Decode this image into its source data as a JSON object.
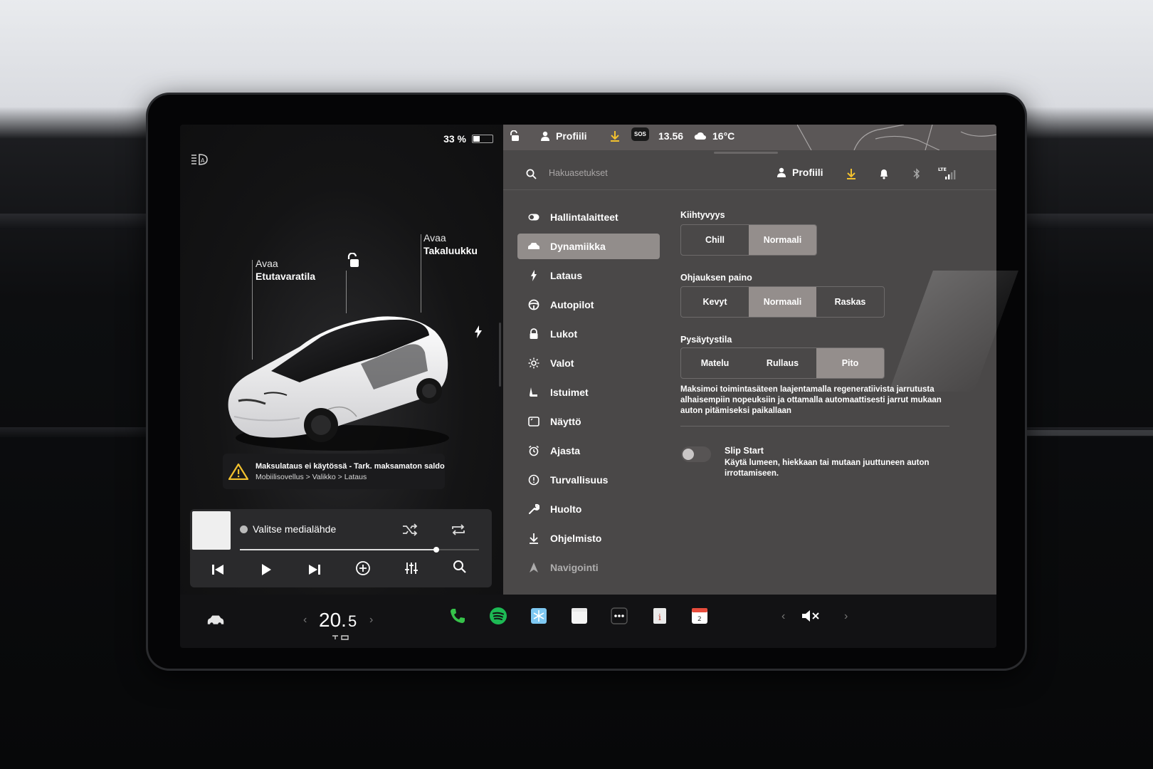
{
  "status_left": {
    "battery_text": "33 %",
    "battery_level": 0.33
  },
  "car_labels": {
    "frunk_line1": "Avaa",
    "frunk_line2": "Etutavaratila",
    "trunk_line1": "Avaa",
    "trunk_line2": "Takaluukku"
  },
  "warning": {
    "title": "Maksulataus ei käytössä - Tark. maksamaton saldo",
    "path": "Mobiilisovellus > Valikko > Lataus"
  },
  "media": {
    "source_label": "Valitse medialähde",
    "progress": 0.82
  },
  "topbar": {
    "profile": "Profiili",
    "sos": "SOS",
    "time": "13.56",
    "weather": "16°C"
  },
  "search": {
    "placeholder": "Hakuasetukset",
    "profile": "Profiili",
    "network": "LTE"
  },
  "menu": [
    {
      "label": "Hallintalaitteet",
      "icon": "toggle-icon"
    },
    {
      "label": "Dynamiikka",
      "icon": "car-icon"
    },
    {
      "label": "Lataus",
      "icon": "bolt-icon"
    },
    {
      "label": "Autopilot",
      "icon": "steering-wheel-icon"
    },
    {
      "label": "Lukot",
      "icon": "lock-icon"
    },
    {
      "label": "Valot",
      "icon": "sun-icon"
    },
    {
      "label": "Istuimet",
      "icon": "seat-icon"
    },
    {
      "label": "Näyttö",
      "icon": "display-icon"
    },
    {
      "label": "Ajasta",
      "icon": "alarm-clock-icon"
    },
    {
      "label": "Turvallisuus",
      "icon": "info-circle-icon"
    },
    {
      "label": "Huolto",
      "icon": "wrench-icon"
    },
    {
      "label": "Ohjelmisto",
      "icon": "download-icon"
    },
    {
      "label": "Navigointi",
      "icon": "navigation-icon"
    }
  ],
  "settings": {
    "acceleration": {
      "title": "Kiihtyvyys",
      "options": [
        "Chill",
        "Normaali"
      ],
      "selected": "Normaali"
    },
    "steering": {
      "title": "Ohjauksen paino",
      "options": [
        "Kevyt",
        "Normaali",
        "Raskas"
      ],
      "selected": "Normaali"
    },
    "stopping": {
      "title": "Pysäytystila",
      "options": [
        "Matelu",
        "Rullaus",
        "Pito"
      ],
      "selected": "Pito"
    },
    "stopping_desc": "Maksimoi toimintasäteen laajentamalla regeneratiivista jarrutusta alhaisempiin nopeuksiin ja ottamalla automaattisesti jarrut mukaan auton pitämiseksi paikallaan",
    "slip_start": {
      "title": "Slip Start",
      "desc": "Käytä lumeen, hiekkaan tai mutaan juuttuneen auton irrottamiseen.",
      "enabled": false
    }
  },
  "taskbar": {
    "temp_main": "20.",
    "temp_decimal": "5",
    "calendar_day": "2"
  },
  "colors": {
    "selected": "#928d8b",
    "panel": "#4a4848",
    "spotify": "#1db954",
    "phone": "#36c24a"
  }
}
